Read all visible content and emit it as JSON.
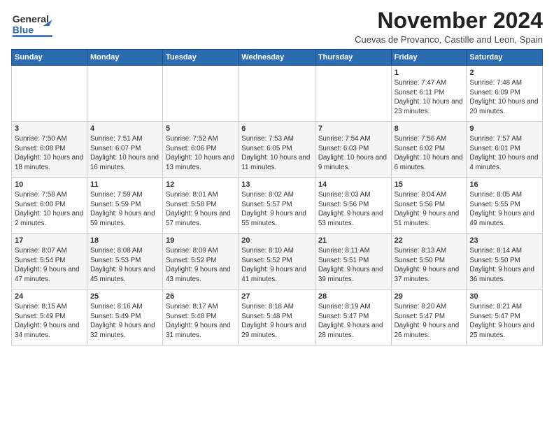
{
  "logo": {
    "line1": "General",
    "line2": "Blue"
  },
  "header": {
    "month_title": "November 2024",
    "subtitle": "Cuevas de Provanco, Castille and Leon, Spain"
  },
  "weekdays": [
    "Sunday",
    "Monday",
    "Tuesday",
    "Wednesday",
    "Thursday",
    "Friday",
    "Saturday"
  ],
  "weeks": [
    {
      "days": [
        {
          "date": "",
          "info": ""
        },
        {
          "date": "",
          "info": ""
        },
        {
          "date": "",
          "info": ""
        },
        {
          "date": "",
          "info": ""
        },
        {
          "date": "",
          "info": ""
        },
        {
          "date": "1",
          "info": "Sunrise: 7:47 AM\nSunset: 6:11 PM\nDaylight: 10 hours and 23 minutes."
        },
        {
          "date": "2",
          "info": "Sunrise: 7:48 AM\nSunset: 6:09 PM\nDaylight: 10 hours and 20 minutes."
        }
      ]
    },
    {
      "days": [
        {
          "date": "3",
          "info": "Sunrise: 7:50 AM\nSunset: 6:08 PM\nDaylight: 10 hours and 18 minutes."
        },
        {
          "date": "4",
          "info": "Sunrise: 7:51 AM\nSunset: 6:07 PM\nDaylight: 10 hours and 16 minutes."
        },
        {
          "date": "5",
          "info": "Sunrise: 7:52 AM\nSunset: 6:06 PM\nDaylight: 10 hours and 13 minutes."
        },
        {
          "date": "6",
          "info": "Sunrise: 7:53 AM\nSunset: 6:05 PM\nDaylight: 10 hours and 11 minutes."
        },
        {
          "date": "7",
          "info": "Sunrise: 7:54 AM\nSunset: 6:03 PM\nDaylight: 10 hours and 9 minutes."
        },
        {
          "date": "8",
          "info": "Sunrise: 7:56 AM\nSunset: 6:02 PM\nDaylight: 10 hours and 6 minutes."
        },
        {
          "date": "9",
          "info": "Sunrise: 7:57 AM\nSunset: 6:01 PM\nDaylight: 10 hours and 4 minutes."
        }
      ]
    },
    {
      "days": [
        {
          "date": "10",
          "info": "Sunrise: 7:58 AM\nSunset: 6:00 PM\nDaylight: 10 hours and 2 minutes."
        },
        {
          "date": "11",
          "info": "Sunrise: 7:59 AM\nSunset: 5:59 PM\nDaylight: 9 hours and 59 minutes."
        },
        {
          "date": "12",
          "info": "Sunrise: 8:01 AM\nSunset: 5:58 PM\nDaylight: 9 hours and 57 minutes."
        },
        {
          "date": "13",
          "info": "Sunrise: 8:02 AM\nSunset: 5:57 PM\nDaylight: 9 hours and 55 minutes."
        },
        {
          "date": "14",
          "info": "Sunrise: 8:03 AM\nSunset: 5:56 PM\nDaylight: 9 hours and 53 minutes."
        },
        {
          "date": "15",
          "info": "Sunrise: 8:04 AM\nSunset: 5:56 PM\nDaylight: 9 hours and 51 minutes."
        },
        {
          "date": "16",
          "info": "Sunrise: 8:05 AM\nSunset: 5:55 PM\nDaylight: 9 hours and 49 minutes."
        }
      ]
    },
    {
      "days": [
        {
          "date": "17",
          "info": "Sunrise: 8:07 AM\nSunset: 5:54 PM\nDaylight: 9 hours and 47 minutes."
        },
        {
          "date": "18",
          "info": "Sunrise: 8:08 AM\nSunset: 5:53 PM\nDaylight: 9 hours and 45 minutes."
        },
        {
          "date": "19",
          "info": "Sunrise: 8:09 AM\nSunset: 5:52 PM\nDaylight: 9 hours and 43 minutes."
        },
        {
          "date": "20",
          "info": "Sunrise: 8:10 AM\nSunset: 5:52 PM\nDaylight: 9 hours and 41 minutes."
        },
        {
          "date": "21",
          "info": "Sunrise: 8:11 AM\nSunset: 5:51 PM\nDaylight: 9 hours and 39 minutes."
        },
        {
          "date": "22",
          "info": "Sunrise: 8:13 AM\nSunset: 5:50 PM\nDaylight: 9 hours and 37 minutes."
        },
        {
          "date": "23",
          "info": "Sunrise: 8:14 AM\nSunset: 5:50 PM\nDaylight: 9 hours and 36 minutes."
        }
      ]
    },
    {
      "days": [
        {
          "date": "24",
          "info": "Sunrise: 8:15 AM\nSunset: 5:49 PM\nDaylight: 9 hours and 34 minutes."
        },
        {
          "date": "25",
          "info": "Sunrise: 8:16 AM\nSunset: 5:49 PM\nDaylight: 9 hours and 32 minutes."
        },
        {
          "date": "26",
          "info": "Sunrise: 8:17 AM\nSunset: 5:48 PM\nDaylight: 9 hours and 31 minutes."
        },
        {
          "date": "27",
          "info": "Sunrise: 8:18 AM\nSunset: 5:48 PM\nDaylight: 9 hours and 29 minutes."
        },
        {
          "date": "28",
          "info": "Sunrise: 8:19 AM\nSunset: 5:47 PM\nDaylight: 9 hours and 28 minutes."
        },
        {
          "date": "29",
          "info": "Sunrise: 8:20 AM\nSunset: 5:47 PM\nDaylight: 9 hours and 26 minutes."
        },
        {
          "date": "30",
          "info": "Sunrise: 8:21 AM\nSunset: 5:47 PM\nDaylight: 9 hours and 25 minutes."
        }
      ]
    }
  ]
}
